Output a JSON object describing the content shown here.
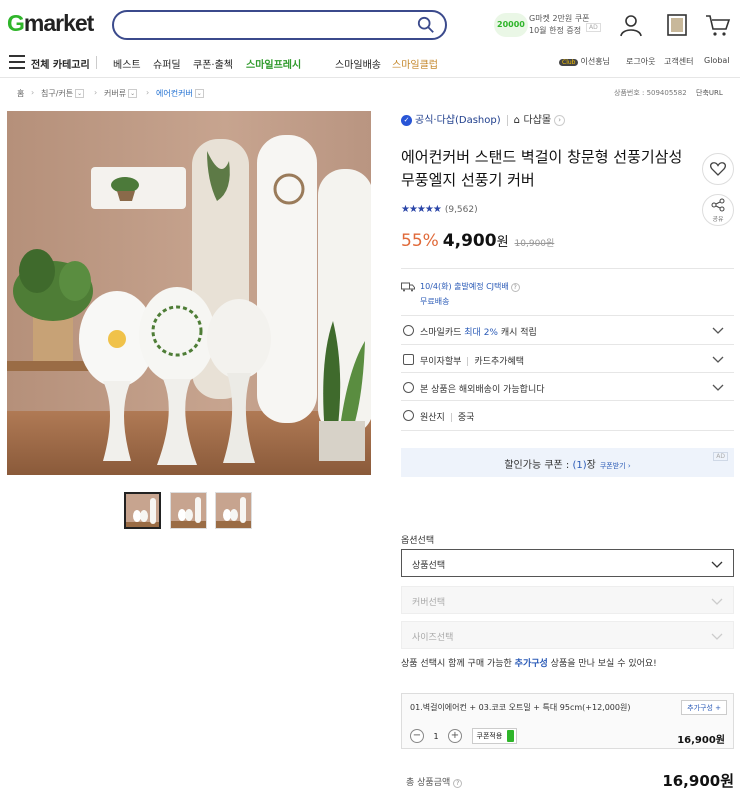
{
  "header": {
    "logo_g": "G",
    "logo_rest": "market",
    "search_placeholder": "",
    "promo": {
      "coin": "20000",
      "line1": "G마켓 2만원 쿠폰",
      "line2": "10월 한정 증정",
      "ad": "AD"
    }
  },
  "nav": {
    "all_categories": "전체 카테고리",
    "items": [
      "베스트",
      "슈퍼딜",
      "쿠폰·출첵",
      "스마일프레시",
      "스마일배송",
      "스마일클럽"
    ],
    "user_badge": "Club",
    "user_name": "이선홍님",
    "logout": "로그아웃",
    "support": "고객센터",
    "global": "Global"
  },
  "breadcrumb": {
    "items": [
      "홈",
      "침구/커튼",
      "커버류",
      "에어컨커버"
    ],
    "product_no": "상품번호 : 509405582",
    "short_url": "단축URL"
  },
  "seller": {
    "official": "공식·다샵(Dashop)",
    "shop": "다샵몰"
  },
  "product": {
    "title": "에어컨커버 스탠드 벽걸이 창문형 선풍기삼성무풍엘지 선풍기 커버",
    "rating_stars": 4.5,
    "review_count": "(9,562)",
    "discount_rate": "55%",
    "price": "4,900",
    "won": "원",
    "original_price": "10,900원",
    "share_label": "공유"
  },
  "shipping": {
    "date": "10/4(화) 출발예정 CJ택배",
    "fee": "무료배송"
  },
  "benefits": [
    {
      "text": "스마일카드",
      "hl": "최대 2%",
      "rest": "캐시 적립"
    },
    {
      "text": "무이자할부",
      "rest": "카드추가혜택"
    },
    {
      "text": "본 상품은 해외배송이 가능합니다"
    },
    {
      "text": "원산지",
      "rest": "중국"
    }
  ],
  "coupon": {
    "label": "할인가능 쿠폰 : ",
    "count": "(1)",
    "unit": "장",
    "more": "쿠폰받기 ›",
    "ad": "AD"
  },
  "options": {
    "heading": "옵션선택",
    "select1": "상품선택",
    "select2": "커버선택",
    "select3": "사이즈선택",
    "hint_pre": "상품 선택시 함께 구매 가능한 ",
    "hint_bold": "추가구성",
    "hint_post": " 상품을 만나 보실 수 있어요!"
  },
  "selected": {
    "name": "01.벽걸이에어컨 + 03.코코 오트밀 + 특대 95cm(+12,000원)",
    "add_button": "추가구성 +",
    "quantity": "1",
    "coupon_apply": "쿠폰적용",
    "subtotal": "16,900원"
  },
  "total": {
    "label": "총 상품금액",
    "amount": "16,900원"
  },
  "colors": {
    "brand_green": "#2fb52a",
    "search_border": "#3b4a8c",
    "discount": "#e06a3a",
    "link_blue": "#2b5bb7"
  }
}
